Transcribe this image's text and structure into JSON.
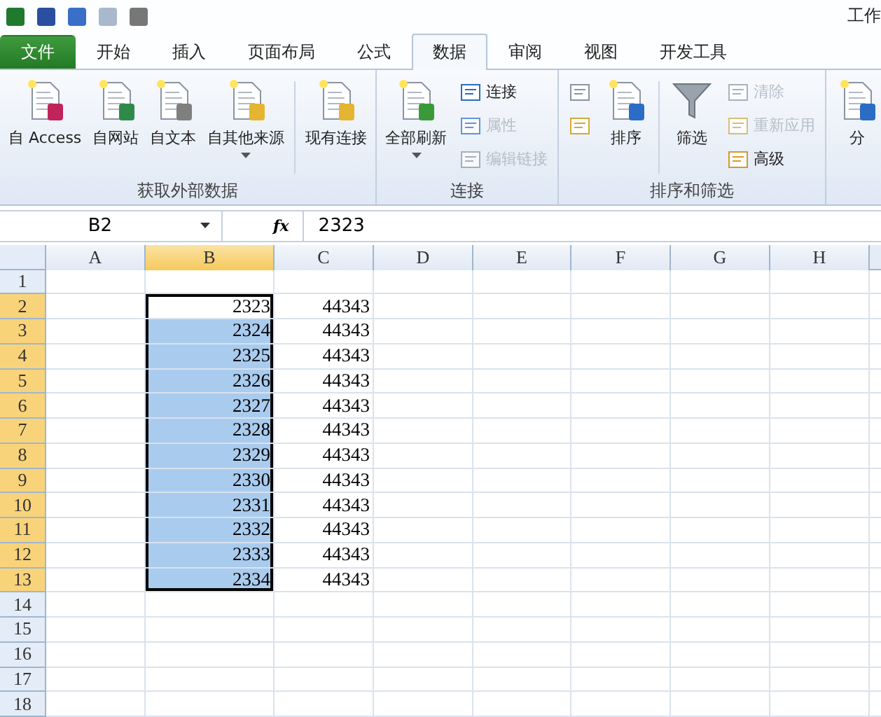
{
  "title": "工作",
  "tabs": [
    {
      "label": "文件",
      "kind": "file",
      "selected": false
    },
    {
      "label": "开始",
      "kind": "tab",
      "selected": false
    },
    {
      "label": "插入",
      "kind": "tab",
      "selected": false
    },
    {
      "label": "页面布局",
      "kind": "tab",
      "selected": false
    },
    {
      "label": "公式",
      "kind": "tab",
      "selected": false
    },
    {
      "label": "数据",
      "kind": "tab",
      "selected": true
    },
    {
      "label": "审阅",
      "kind": "tab",
      "selected": false
    },
    {
      "label": "视图",
      "kind": "tab",
      "selected": false
    },
    {
      "label": "开发工具",
      "kind": "tab",
      "selected": false
    }
  ],
  "ribbon_groups": [
    {
      "label": "获取外部数据",
      "items": [
        {
          "kind": "large",
          "label": "自 Access",
          "dropdown": false
        },
        {
          "kind": "large",
          "label": "自网站",
          "dropdown": false
        },
        {
          "kind": "large",
          "label": "自文本",
          "dropdown": false
        },
        {
          "kind": "large",
          "label": "自其他来源",
          "dropdown": true
        },
        {
          "kind": "separator"
        },
        {
          "kind": "large",
          "label": "现有连接",
          "dropdown": false
        }
      ]
    },
    {
      "label": "连接",
      "items": [
        {
          "kind": "large",
          "label": "全部刷新",
          "dropdown": true
        },
        {
          "kind": "stack",
          "items": [
            {
              "label": "连接",
              "disabled": false
            },
            {
              "label": "属性",
              "disabled": true
            },
            {
              "label": "编辑链接",
              "disabled": true
            }
          ]
        }
      ]
    },
    {
      "label": "排序和筛选",
      "items": [
        {
          "kind": "stack",
          "items": [
            {
              "disabled": false
            },
            {
              "disabled": false
            }
          ]
        },
        {
          "kind": "large",
          "label": "排序",
          "dropdown": false
        },
        {
          "kind": "separator"
        },
        {
          "kind": "large",
          "label": "筛选",
          "dropdown": false
        },
        {
          "kind": "stack",
          "items": [
            {
              "label": "清除",
              "disabled": true
            },
            {
              "label": "重新应用",
              "disabled": true
            },
            {
              "label": "高级",
              "disabled": false
            }
          ]
        }
      ]
    },
    {
      "items": [
        {
          "kind": "large",
          "label": "分",
          "dropdown": false
        }
      ]
    }
  ],
  "formula_bar": {
    "name_box": "B2",
    "function_label": "fx",
    "value": "2323"
  },
  "sheet": {
    "columns": [
      {
        "label": "A",
        "selected": false
      },
      {
        "label": "B",
        "selected": true
      },
      {
        "label": "C",
        "selected": false
      },
      {
        "label": "D",
        "selected": false
      },
      {
        "label": "E",
        "selected": false
      },
      {
        "label": "F",
        "selected": false
      },
      {
        "label": "G",
        "selected": false
      },
      {
        "label": "H",
        "selected": false
      }
    ],
    "rows": [
      {
        "label": "1",
        "selected": false,
        "cells": []
      },
      {
        "label": "2",
        "selected": true,
        "cells": [
          {
            "selected": false
          },
          {
            "value": "2323",
            "selected": true,
            "active": true
          },
          {
            "value": "44343",
            "selected": false
          }
        ]
      },
      {
        "label": "3",
        "selected": true,
        "cells": [
          {
            "selected": false
          },
          {
            "value": "2324",
            "selected": true,
            "active": false
          },
          {
            "value": "44343",
            "selected": false
          }
        ]
      },
      {
        "label": "4",
        "selected": true,
        "cells": [
          {
            "selected": false
          },
          {
            "value": "2325",
            "selected": true,
            "active": false
          },
          {
            "value": "44343",
            "selected": false
          }
        ]
      },
      {
        "label": "5",
        "selected": true,
        "cells": [
          {
            "selected": false
          },
          {
            "value": "2326",
            "selected": true,
            "active": false
          },
          {
            "value": "44343",
            "selected": false
          }
        ]
      },
      {
        "label": "6",
        "selected": true,
        "cells": [
          {
            "selected": false
          },
          {
            "value": "2327",
            "selected": true,
            "active": false
          },
          {
            "value": "44343",
            "selected": false
          }
        ]
      },
      {
        "label": "7",
        "selected": true,
        "cells": [
          {
            "selected": false
          },
          {
            "value": "2328",
            "selected": true,
            "active": false
          },
          {
            "value": "44343",
            "selected": false
          }
        ]
      },
      {
        "label": "8",
        "selected": true,
        "cells": [
          {
            "selected": false
          },
          {
            "value": "2329",
            "selected": true,
            "active": false
          },
          {
            "value": "44343",
            "selected": false
          }
        ]
      },
      {
        "label": "9",
        "selected": true,
        "cells": [
          {
            "selected": false
          },
          {
            "value": "2330",
            "selected": true,
            "active": false
          },
          {
            "value": "44343",
            "selected": false
          }
        ]
      },
      {
        "label": "10",
        "selected": true,
        "cells": [
          {
            "selected": false
          },
          {
            "value": "2331",
            "selected": true,
            "active": false
          },
          {
            "value": "44343",
            "selected": false
          }
        ]
      },
      {
        "label": "11",
        "selected": true,
        "cells": [
          {
            "selected": false
          },
          {
            "value": "2332",
            "selected": true,
            "active": false
          },
          {
            "value": "44343",
            "selected": false
          }
        ]
      },
      {
        "label": "12",
        "selected": true,
        "cells": [
          {
            "selected": false
          },
          {
            "value": "2333",
            "selected": true,
            "active": false
          },
          {
            "value": "44343",
            "selected": false
          }
        ]
      },
      {
        "label": "13",
        "selected": true,
        "cells": [
          {
            "selected": false
          },
          {
            "value": "2334",
            "selected": true,
            "active": false
          },
          {
            "value": "44343",
            "selected": false
          }
        ]
      },
      {
        "label": "14",
        "selected": false,
        "cells": []
      },
      {
        "label": "15",
        "selected": false,
        "cells": []
      },
      {
        "label": "16",
        "selected": false,
        "cells": []
      },
      {
        "label": "17",
        "selected": false,
        "cells": []
      },
      {
        "label": "18",
        "selected": false,
        "cells": []
      }
    ]
  }
}
